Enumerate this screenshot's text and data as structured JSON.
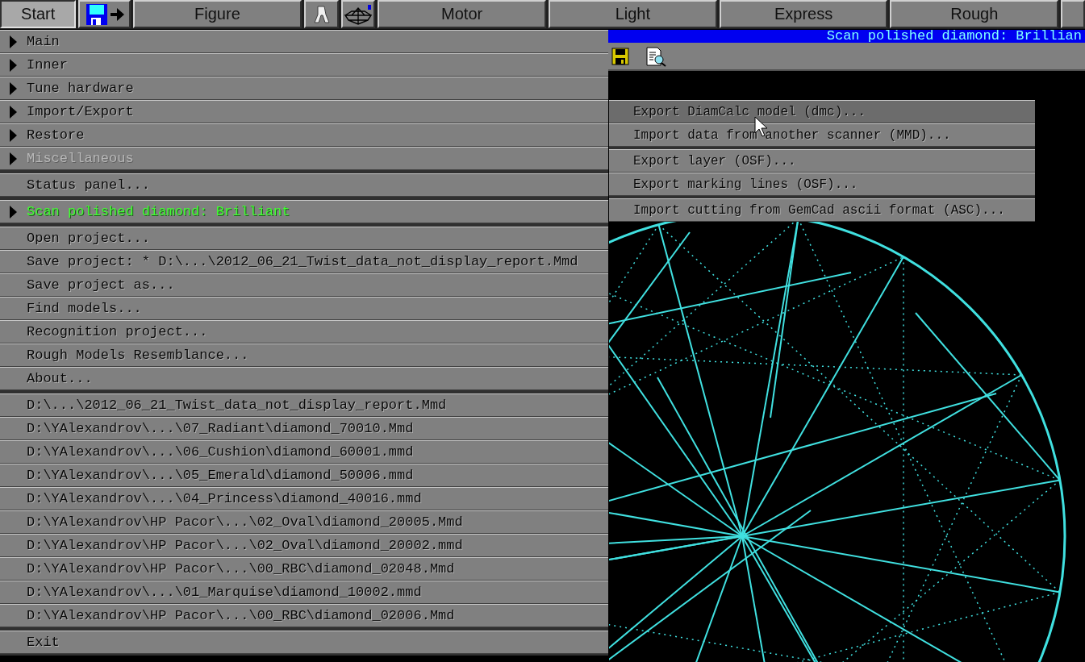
{
  "top_bar": {
    "buttons": [
      {
        "kind": "text",
        "label": "Start",
        "selected": true
      },
      {
        "kind": "disk",
        "selected": false
      },
      {
        "kind": "text",
        "label": "Figure",
        "selected": false
      },
      {
        "kind": "walker",
        "selected": false
      },
      {
        "kind": "gem",
        "selected": false
      },
      {
        "kind": "text",
        "label": "Motor",
        "selected": false
      },
      {
        "kind": "text",
        "label": "Light",
        "selected": false
      },
      {
        "kind": "text",
        "label": "Express",
        "selected": false
      },
      {
        "kind": "text",
        "label": "Rough",
        "selected": false
      }
    ]
  },
  "window": {
    "title": "Scan polished diamond: Brillian"
  },
  "menu": {
    "groups": [
      {
        "items": [
          {
            "label": "Main",
            "submenu": true,
            "disabled": false,
            "current": false
          },
          {
            "label": "Inner",
            "submenu": true,
            "disabled": false,
            "current": false
          },
          {
            "label": "Tune hardware",
            "submenu": true,
            "disabled": false,
            "current": false
          },
          {
            "label": "Import/Export",
            "submenu": true,
            "disabled": false,
            "current": false
          },
          {
            "label": "Restore",
            "submenu": true,
            "disabled": false,
            "current": false
          },
          {
            "label": "Miscellaneous",
            "submenu": true,
            "disabled": true,
            "current": false
          }
        ]
      },
      {
        "items": [
          {
            "label": "Status panel...",
            "submenu": false,
            "disabled": false,
            "current": false
          }
        ]
      },
      {
        "items": [
          {
            "label": "Scan polished diamond: Brilliant",
            "submenu": true,
            "disabled": false,
            "current": true
          }
        ]
      },
      {
        "items": [
          {
            "label": "Open project...",
            "submenu": false,
            "disabled": false,
            "current": false
          },
          {
            "label": "Save project: * D:\\...\\2012_06_21_Twist_data_not_display_report.Mmd",
            "submenu": false,
            "disabled": false,
            "current": false
          },
          {
            "label": "Save project as...",
            "submenu": false,
            "disabled": false,
            "current": false
          },
          {
            "label": "Find models...",
            "submenu": false,
            "disabled": false,
            "current": false
          },
          {
            "label": "Recognition project...",
            "submenu": false,
            "disabled": false,
            "current": false
          },
          {
            "label": "Rough Models Resemblance...",
            "submenu": false,
            "disabled": false,
            "current": false
          },
          {
            "label": "About...",
            "submenu": false,
            "disabled": false,
            "current": false
          }
        ]
      },
      {
        "items": [
          {
            "label": "D:\\...\\2012_06_21_Twist_data_not_display_report.Mmd",
            "submenu": false,
            "disabled": false,
            "current": false
          },
          {
            "label": "D:\\YAlexandrov\\...\\07_Radiant\\diamond_70010.Mmd",
            "submenu": false,
            "disabled": false,
            "current": false
          },
          {
            "label": "D:\\YAlexandrov\\...\\06_Cushion\\diamond_60001.mmd",
            "submenu": false,
            "disabled": false,
            "current": false
          },
          {
            "label": "D:\\YAlexandrov\\...\\05_Emerald\\diamond_50006.mmd",
            "submenu": false,
            "disabled": false,
            "current": false
          },
          {
            "label": "D:\\YAlexandrov\\...\\04_Princess\\diamond_40016.mmd",
            "submenu": false,
            "disabled": false,
            "current": false
          },
          {
            "label": "D:\\YAlexandrov\\HP Pacor\\...\\02_Oval\\diamond_20005.Mmd",
            "submenu": false,
            "disabled": false,
            "current": false
          },
          {
            "label": "D:\\YAlexandrov\\HP Pacor\\...\\02_Oval\\diamond_20002.mmd",
            "submenu": false,
            "disabled": false,
            "current": false
          },
          {
            "label": "D:\\YAlexandrov\\HP Pacor\\...\\00_RBC\\diamond_02048.Mmd",
            "submenu": false,
            "disabled": false,
            "current": false
          },
          {
            "label": "D:\\YAlexandrov\\...\\01_Marquise\\diamond_10002.mmd",
            "submenu": false,
            "disabled": false,
            "current": false
          },
          {
            "label": "D:\\YAlexandrov\\HP Pacor\\...\\00_RBC\\diamond_02006.Mmd",
            "submenu": false,
            "disabled": false,
            "current": false
          }
        ]
      },
      {
        "items": [
          {
            "label": "Exit",
            "submenu": false,
            "disabled": false,
            "current": false
          }
        ]
      }
    ]
  },
  "submenu": {
    "groups": [
      {
        "items": [
          {
            "label": "Export DiamCalc model (dmc)...",
            "selected": true
          },
          {
            "label": "Import data from another scanner (MMD)...",
            "selected": false
          }
        ]
      },
      {
        "items": [
          {
            "label": "Export layer (OSF)...",
            "selected": false
          },
          {
            "label": "Export marking lines (OSF)...",
            "selected": false
          }
        ]
      },
      {
        "items": [
          {
            "label": "Import cutting from GemCad ascii format (ASC)...",
            "selected": false
          }
        ]
      }
    ]
  }
}
